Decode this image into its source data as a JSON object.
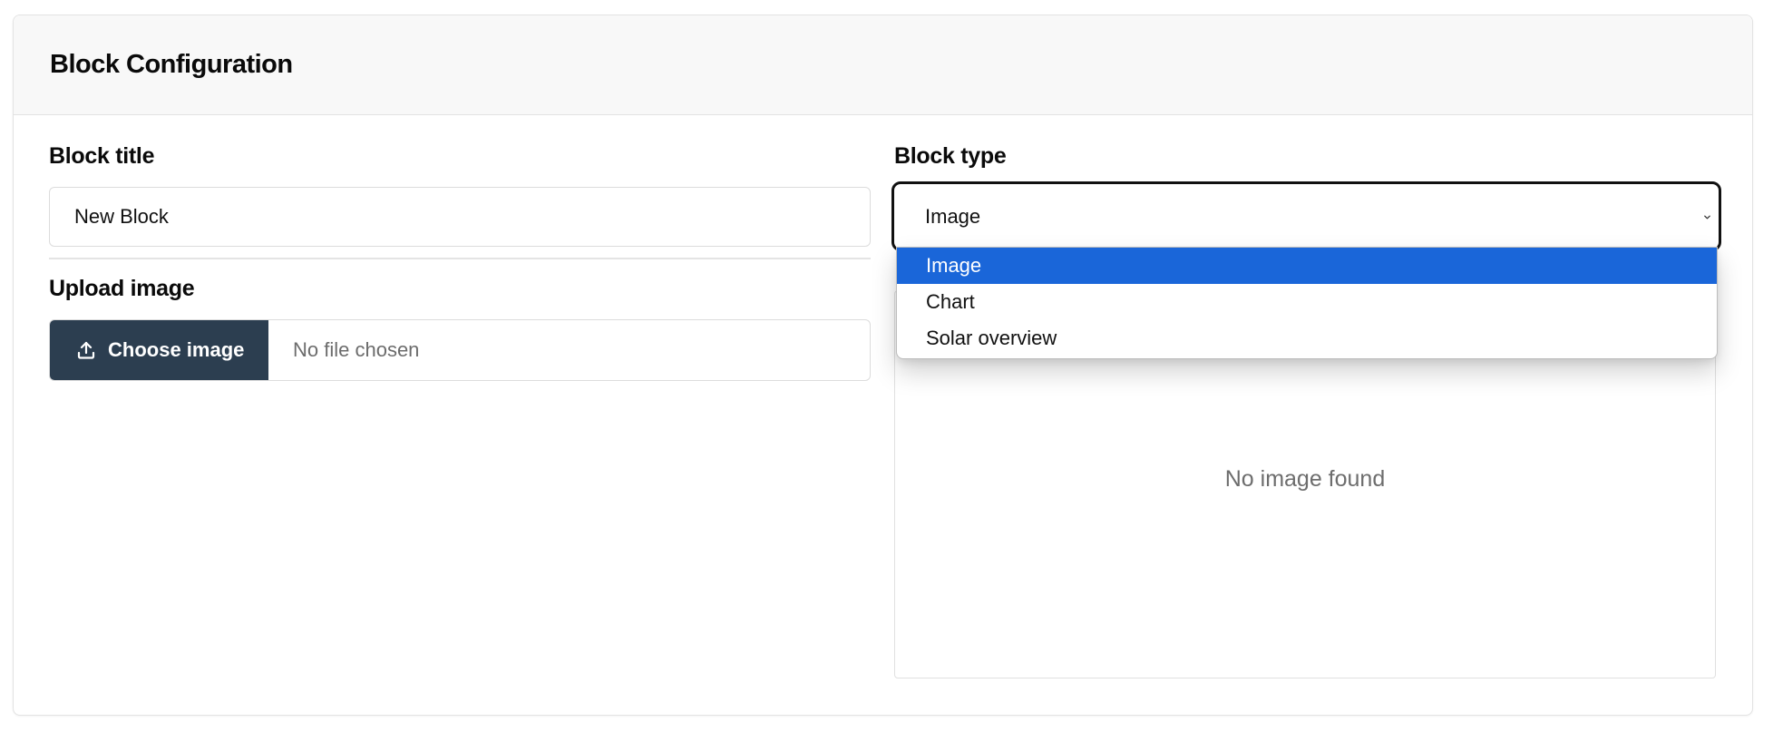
{
  "card": {
    "title": "Block Configuration"
  },
  "form": {
    "block_title": {
      "label": "Block title",
      "value": "New Block"
    },
    "upload": {
      "label": "Upload image",
      "button_label": "Choose image",
      "status": "No file chosen"
    },
    "block_type": {
      "label": "Block type",
      "selected": "Image",
      "options": [
        "Image",
        "Chart",
        "Solar overview"
      ]
    }
  },
  "preview": {
    "empty_text": "No image found"
  },
  "icons": {
    "upload": "upload-icon",
    "chevron": "chevron-down-icon"
  },
  "colors": {
    "button_bg": "#2c3e50",
    "option_highlight": "#1a66d9",
    "header_bg": "#f8f8f8"
  }
}
